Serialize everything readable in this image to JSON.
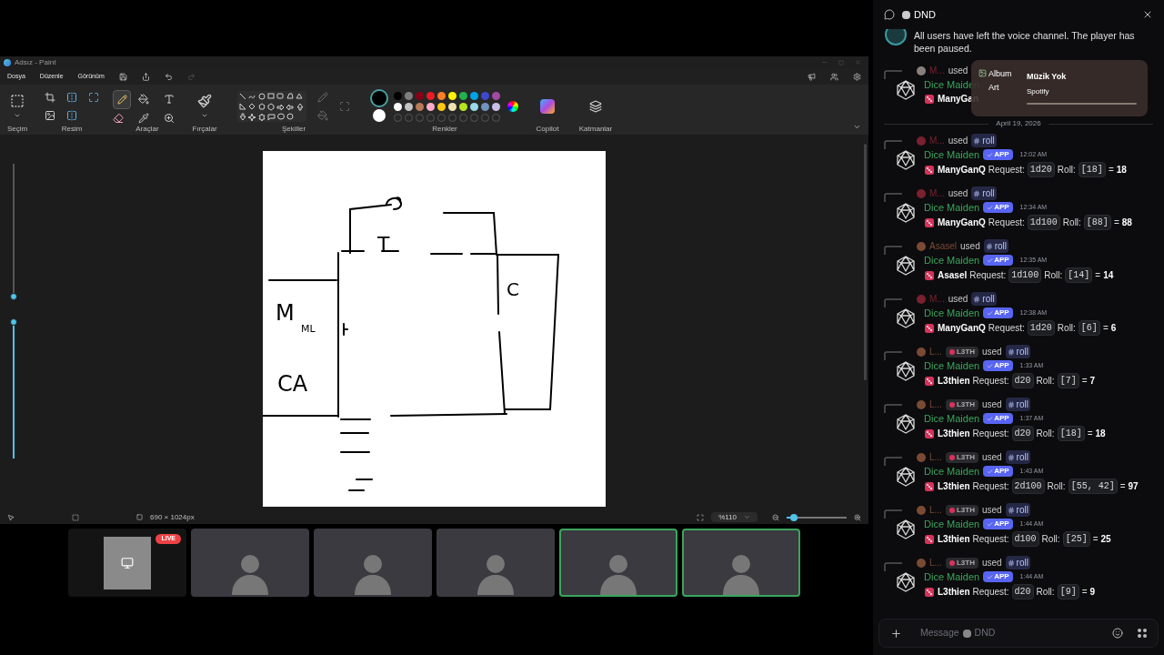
{
  "paint": {
    "title": "Adsız - Paint",
    "menu": [
      "Dosya",
      "Düzenle",
      "Görünüm"
    ],
    "groups": [
      {
        "kind": "select",
        "label": "Seçim"
      },
      {
        "kind": "image",
        "label": "Resim"
      },
      {
        "kind": "tools",
        "label": "Araçlar"
      },
      {
        "kind": "brushes",
        "label": "Fırçalar"
      },
      {
        "kind": "shapes",
        "label": "Şekiller"
      },
      {
        "kind": "colors",
        "label": "Renkler"
      },
      {
        "kind": "copilot",
        "label": "Copilot"
      },
      {
        "kind": "layers",
        "label": "Katmanlar"
      }
    ],
    "current_colors": [
      {
        "color": "#000000"
      },
      {
        "color": "#ffffff"
      }
    ],
    "swatches": [
      {
        "color": "#000000"
      },
      {
        "color": "#7f7f7f"
      },
      {
        "color": "#880015"
      },
      {
        "color": "#ed1c24"
      },
      {
        "color": "#ff7f27"
      },
      {
        "color": "#fff200"
      },
      {
        "color": "#22b14c"
      },
      {
        "color": "#00a2e8"
      },
      {
        "color": "#3f48cc"
      },
      {
        "color": "#a349a4"
      },
      {
        "color": "#ffffff"
      },
      {
        "color": "#c3c3c3"
      },
      {
        "color": "#b97a57"
      },
      {
        "color": "#ffaec9"
      },
      {
        "color": "#ffc90e"
      },
      {
        "color": "#efe4b0"
      },
      {
        "color": "#b5e61d"
      },
      {
        "color": "#99d9ea"
      },
      {
        "color": "#7092be"
      },
      {
        "color": "#c8bfe7"
      }
    ],
    "side_sliders": [
      {
        "level": 0.03
      },
      {
        "level": 1
      }
    ],
    "canvas_labels": [
      "T",
      "C",
      "M",
      "ML",
      "CA"
    ],
    "size_readout": "690 × 1024px",
    "zoom": {
      "reading": "%110",
      "level": 0.12
    }
  },
  "video_tiles": [
    {
      "kind": "screen",
      "badge": "LIVE",
      "speaking": false
    },
    {
      "kind": "camera",
      "speaking": false
    },
    {
      "kind": "camera",
      "speaking": false
    },
    {
      "kind": "camera",
      "speaking": false
    },
    {
      "kind": "camera",
      "speaking": true
    },
    {
      "kind": "camera",
      "speaking": true
    }
  ],
  "chat": {
    "channel": "DND",
    "system_message": "All users have left the voice channel. The player has been paused.",
    "partial_message": {
      "user": "M...",
      "used": "used",
      "bot": "Dice Maiden",
      "requester": "ManyGan"
    },
    "overlay": {
      "art_alt": "Album Art",
      "title": "Müzik Yok",
      "source": "Spotify"
    },
    "date_divider": "April 19, 2026",
    "messages": [
      {
        "user": "M...",
        "color": "#7a2030",
        "used": "used",
        "command": "roll",
        "bot": "Dice Maiden",
        "app": "APP",
        "time": "12:02 AM",
        "requester": "ManyGanQ",
        "request_label": "Request:",
        "dice": "1d20",
        "roll_label": "Roll:",
        "rolls": "[18]",
        "equals": "=",
        "total": "18"
      },
      {
        "user": "M...",
        "color": "#7a2030",
        "used": "used",
        "command": "roll",
        "bot": "Dice Maiden",
        "app": "APP",
        "time": "12:34 AM",
        "requester": "ManyGanQ",
        "request_label": "Request:",
        "dice": "1d100",
        "roll_label": "Roll:",
        "rolls": "[88]",
        "equals": "=",
        "total": "88"
      },
      {
        "user": "Asasel",
        "color": "#7a4a34",
        "used": "used",
        "command": "roll",
        "bot": "Dice Maiden",
        "app": "APP",
        "time": "12:35 AM",
        "requester": "Asasel",
        "request_label": "Request:",
        "dice": "1d100",
        "roll_label": "Roll:",
        "rolls": "[14]",
        "equals": "=",
        "total": "14"
      },
      {
        "user": "M...",
        "color": "#7a2030",
        "used": "used",
        "command": "roll",
        "bot": "Dice Maiden",
        "app": "APP",
        "time": "12:38 AM",
        "requester": "ManyGanQ",
        "request_label": "Request:",
        "dice": "1d20",
        "roll_label": "Roll:",
        "rolls": "[6]",
        "equals": "=",
        "total": "6"
      },
      {
        "user": "L...",
        "color": "#7a4a34",
        "tag": "L3TH",
        "used": "used",
        "command": "roll",
        "bot": "Dice Maiden",
        "app": "APP",
        "time": "1:33 AM",
        "requester": "L3thien",
        "request_label": "Request:",
        "dice": "d20",
        "roll_label": "Roll:",
        "rolls": "[7]",
        "equals": "=",
        "total": "7"
      },
      {
        "user": "L...",
        "color": "#7a4a34",
        "tag": "L3TH",
        "used": "used",
        "command": "roll",
        "bot": "Dice Maiden",
        "app": "APP",
        "time": "1:37 AM",
        "requester": "L3thien",
        "request_label": "Request:",
        "dice": "d20",
        "roll_label": "Roll:",
        "rolls": "[18]",
        "equals": "=",
        "total": "18"
      },
      {
        "user": "L...",
        "color": "#7a4a34",
        "tag": "L3TH",
        "used": "used",
        "command": "roll",
        "bot": "Dice Maiden",
        "app": "APP",
        "time": "1:43 AM",
        "requester": "L3thien",
        "request_label": "Request:",
        "dice": "2d100",
        "roll_label": "Roll:",
        "rolls": "[55, 42]",
        "equals": "=",
        "total": "97"
      },
      {
        "user": "L...",
        "color": "#7a4a34",
        "tag": "L3TH",
        "used": "used",
        "command": "roll",
        "bot": "Dice Maiden",
        "app": "APP",
        "time": "1:44 AM",
        "requester": "L3thien",
        "request_label": "Request:",
        "dice": "d100",
        "roll_label": "Roll:",
        "rolls": "[25]",
        "equals": "=",
        "total": "25"
      },
      {
        "user": "L...",
        "color": "#7a4a34",
        "tag": "L3TH",
        "used": "used",
        "command": "roll",
        "bot": "Dice Maiden",
        "app": "APP",
        "time": "1:44 AM",
        "requester": "L3thien",
        "request_label": "Request:",
        "dice": "d20",
        "roll_label": "Roll:",
        "rolls": "[9]",
        "equals": "=",
        "total": "9"
      }
    ],
    "input": {
      "placeholder_start": "Message",
      "placeholder_end": "DND"
    }
  }
}
